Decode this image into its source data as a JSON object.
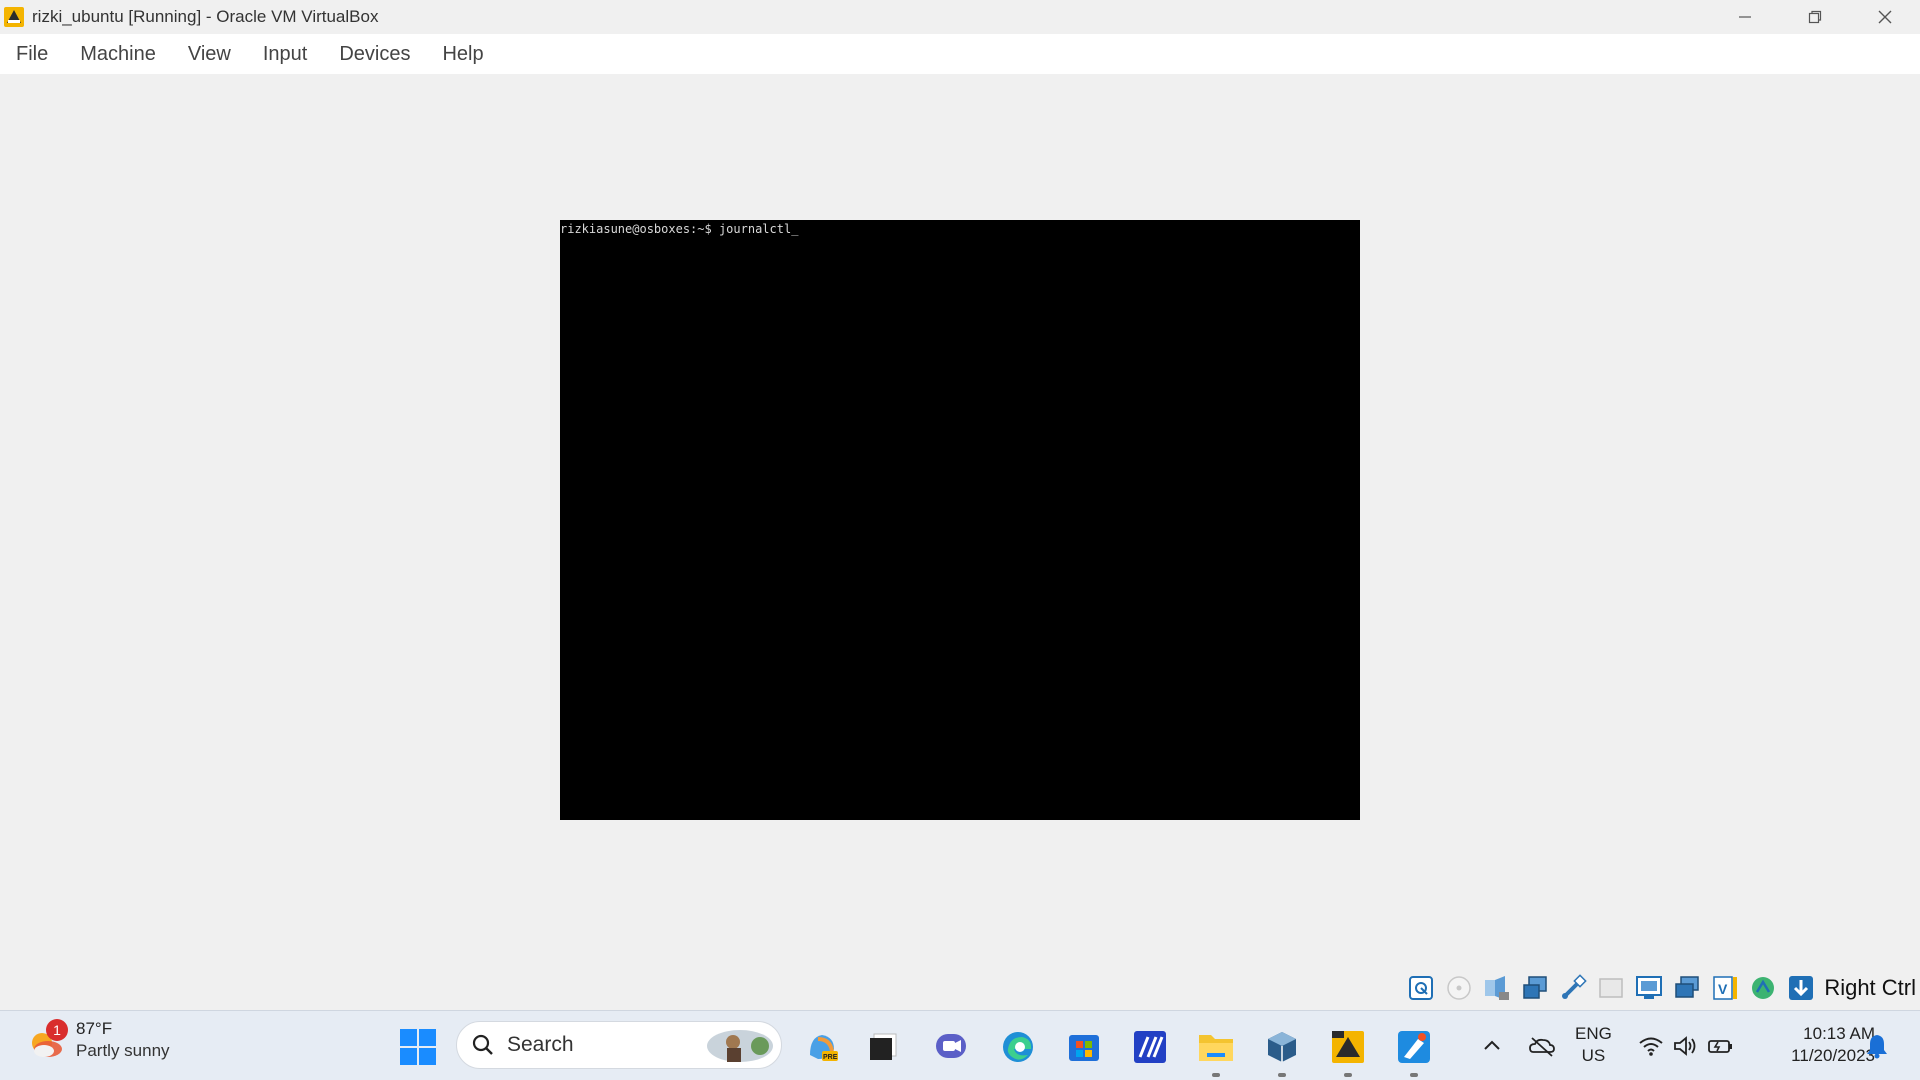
{
  "window": {
    "title": "rizki_ubuntu [Running] - Oracle VM VirtualBox",
    "controls": [
      "minimize-icon",
      "restore-icon",
      "close-icon"
    ]
  },
  "menubar": {
    "items": [
      {
        "label": "File"
      },
      {
        "label": "Machine"
      },
      {
        "label": "View"
      },
      {
        "label": "Input"
      },
      {
        "label": "Devices"
      },
      {
        "label": "Help"
      }
    ]
  },
  "console": {
    "prompt_line": "rizkiasune@osboxes:~$ journalctl_"
  },
  "statusbar": {
    "icons": [
      "hard-disk-icon",
      "optical-drive-icon",
      "audio-icon",
      "network-icon",
      "usb-icon",
      "shared-folders-icon",
      "display-icon",
      "recording-icon",
      "virtualization-icon",
      "mouse-integration-icon",
      "download-icon"
    ],
    "host_key": "Right Ctrl"
  },
  "taskbar": {
    "weather": {
      "badge": "1",
      "temperature": "87°F",
      "description": "Partly sunny"
    },
    "search": {
      "label": "Search"
    },
    "apps": [
      "copilot-icon",
      "task-view-icon",
      "chat-icon",
      "edge-icon",
      "store-icon",
      "vs-code-like-icon",
      "file-explorer-icon",
      "virtualbox-icon",
      "virtualbox-vm-icon",
      "paint-icon"
    ],
    "tray": {
      "lang_primary": "ENG",
      "lang_secondary": "US",
      "time": "10:13 AM",
      "date": "11/20/2023"
    }
  },
  "colors": {
    "window_bg": "#f0f0f0",
    "menubar_bg": "#ffffff",
    "console_bg": "#000000",
    "taskbar_bg": "#e6ecf4",
    "accent_blue": "#0078d4"
  }
}
